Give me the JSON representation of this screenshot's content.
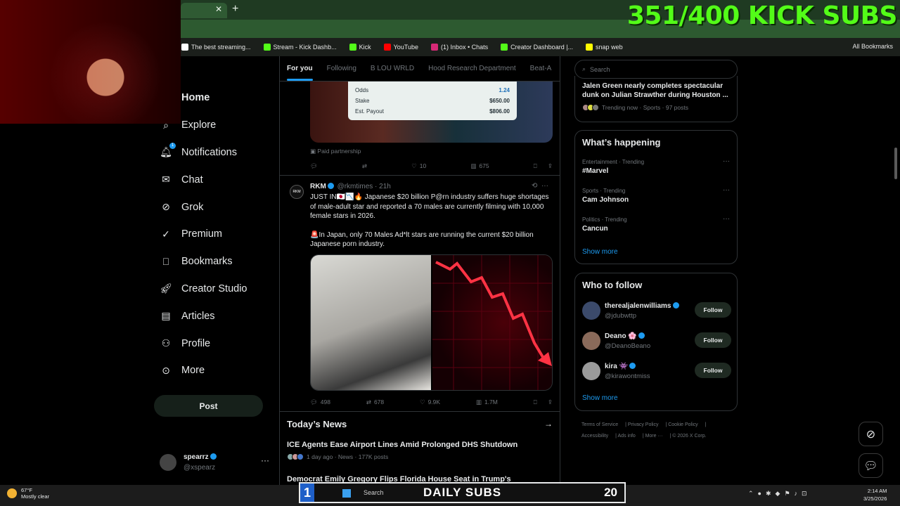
{
  "overlay": {
    "kick_subs": "351/400 KICK SUBS",
    "daily_subs_label": "DAILY SUBS",
    "daily_subs_left": "1",
    "daily_subs_count": "20"
  },
  "bookmarks": [
    {
      "label": "The best streaming...",
      "color": "#ffffff"
    },
    {
      "label": "Stream - Kick Dashb...",
      "color": "#53fc18"
    },
    {
      "label": "Kick",
      "color": "#53fc18"
    },
    {
      "label": "YouTube",
      "color": "#ff0000"
    },
    {
      "label": "(1) Inbox • Chats",
      "color": "#d62976"
    },
    {
      "label": "Creator Dashboard |...",
      "color": "#53fc18"
    },
    {
      "label": "snap web",
      "color": "#fffc00"
    }
  ],
  "all_bookmarks": "All Bookmarks",
  "nav": {
    "home": "Home",
    "explore": "Explore",
    "notifications": "Notifications",
    "notif_count": "1",
    "chat": "Chat",
    "grok": "Grok",
    "premium": "Premium",
    "bookmarks": "Bookmarks",
    "creator_studio": "Creator Studio",
    "articles": "Articles",
    "profile": "Profile",
    "more": "More",
    "post": "Post"
  },
  "account": {
    "name": "spearrz",
    "handle": "@xspearz"
  },
  "feed_tabs": [
    "For you",
    "Following",
    "B LOU WRLD",
    "Hood Research Department",
    "Beat-A"
  ],
  "post1": {
    "odds_label": "Odds",
    "odds_value": "1.24",
    "stake_label": "Stake",
    "stake_value": "$650.00",
    "payout_label": "Est. Payout",
    "payout_value": "$806.00",
    "paid": "Paid partnership",
    "likes": "10",
    "views": "675"
  },
  "post2": {
    "name": "RKM",
    "handle": "@rkmtimes",
    "time": "21h",
    "avatar_text": "RKM",
    "para1": "JUST IN🇯🇵📉🔥 Japanese $20 billion P@rn industry suffers huge shortages of  male-adult star and reported a 70 males are currently filming with 10,000 female stars in 2026.",
    "para2": "🚨In Japan, only 70 Males Ad*lt stars are running the current $20 billion Japanese porn industry.",
    "replies": "498",
    "reposts": "678",
    "likes": "9.9K",
    "views": "1.7M"
  },
  "news": {
    "title": "Today’s News",
    "item1_title": "ICE Agents Ease Airport Lines Amid Prolonged DHS Shutdown",
    "item1_meta": "1 day ago · News · 177K posts",
    "item2_title": "Democrat Emily Gregory Flips Florida House Seat in Trump's"
  },
  "search": {
    "placeholder": "Search"
  },
  "top_trend": {
    "text": "Jalen Green nearly completes spectacular dunk on Julian Strawther during Houston ...",
    "meta": "Trending now · Sports · 97 posts"
  },
  "happening": {
    "title": "What’s happening",
    "trends": [
      {
        "cat": "Entertainment · Trending",
        "name": "#Marvel"
      },
      {
        "cat": "Sports · Trending",
        "name": "Cam Johnson"
      },
      {
        "cat": "Politics · Trending",
        "name": "Cancun"
      }
    ],
    "show_more": "Show more"
  },
  "who_to_follow": {
    "title": "Who to follow",
    "users": [
      {
        "name": "therealjalenwilliams",
        "handle": "@jdubwttp",
        "btn": "Follow",
        "color": "#3b4a6b"
      },
      {
        "name": "Deano 🌸",
        "handle": "@DeanoBeano",
        "btn": "Follow",
        "color": "#8a6a5a"
      },
      {
        "name": "kira 👾",
        "handle": "@kirawontmiss",
        "btn": "Follow",
        "color": "#9a9a9a"
      }
    ],
    "show_more": "Show more"
  },
  "footer": {
    "line1": [
      "Terms of Service",
      "Privacy Policy",
      "Cookie Policy"
    ],
    "line2": [
      "Accessibility",
      "Ads info",
      "More ···",
      "© 2026 X Corp."
    ]
  },
  "taskbar": {
    "temp": "67°F",
    "condition": "Mostly clear",
    "search": "Search",
    "time": "2:14 AM",
    "date": "3/25/2026"
  }
}
